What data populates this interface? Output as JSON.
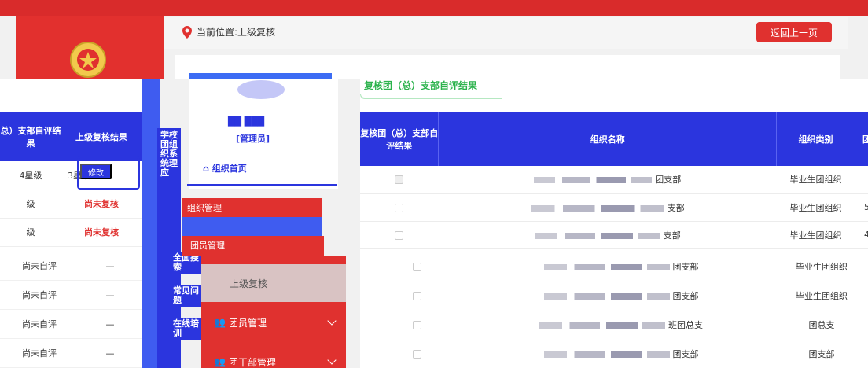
{
  "breadcrumb": {
    "label": "当前位置:上级复核"
  },
  "back_button": "返回上一页",
  "tab_title": "复核团（总）支部自评结果",
  "account": {
    "name": "██ ███",
    "role": "[管理员]",
    "home": "组织首页"
  },
  "left_table": {
    "headers": [
      "总）支部自评结果",
      "上级复核结果"
    ],
    "rows": [
      {
        "self": "4星级",
        "review": "3星级",
        "action": "修改"
      },
      {
        "self": "级",
        "review": "尚未复核"
      },
      {
        "self": "级",
        "review": "尚未复核"
      },
      {
        "self": "尚未自评",
        "review": "—"
      },
      {
        "self": "尚未自评",
        "review": "—"
      },
      {
        "self": "尚未自评",
        "review": "—"
      },
      {
        "self": "尚未自评",
        "review": "—"
      }
    ]
  },
  "main_table": {
    "headers": [
      "复核团（总）支部自评结果",
      "组织名称",
      "组织类别",
      "团"
    ],
    "rows": [
      {
        "checked": true,
        "name_suffix": "团支部",
        "category": "毕业生团组织"
      },
      {
        "checked": false,
        "name_suffix": "支部",
        "category": "毕业生团组织",
        "extra": "5"
      },
      {
        "checked": false,
        "name_suffix": "支部",
        "category": "毕业生团组织",
        "extra": "4"
      }
    ]
  },
  "lower_rows": [
    {
      "name_suffix": "团支部",
      "category": "毕业生团组织"
    },
    {
      "name_suffix": "团支部",
      "category": "毕业生团组织"
    },
    {
      "name_suffix": "班团总支",
      "category": "团总支"
    },
    {
      "name_suffix": "团支部",
      "category": "团支部"
    }
  ],
  "sidebar_vertical": "学校团组织系统理应",
  "sidebar_entries": [
    "全面搜索",
    "常见问题",
    "在线培训"
  ],
  "glitch_menu": [
    "组织管理",
    "团员管理"
  ],
  "menu": {
    "current": "上级复核",
    "items": [
      {
        "label": "团员管理"
      },
      {
        "label": "团干部管理"
      }
    ]
  },
  "colors": {
    "brand_red": "#e0312f",
    "brand_blue": "#2b35de",
    "accent_green": "#2bb24c"
  }
}
